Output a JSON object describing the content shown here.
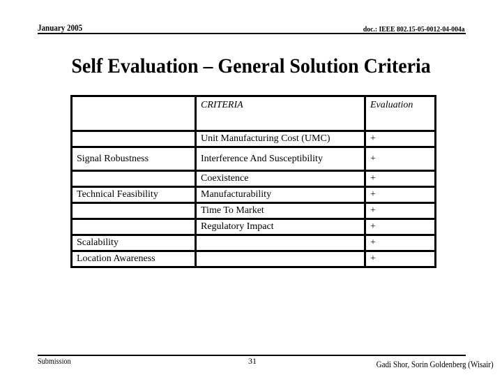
{
  "header": {
    "date": "January 2005",
    "doc_id": "doc.: IEEE 802.15-05-0012-04-004a"
  },
  "title": "Self Evaluation – General Solution Criteria",
  "table": {
    "columns": [
      "",
      "CRITERIA",
      "Evaluation"
    ],
    "rows": [
      [
        "",
        "Unit Manufacturing Cost (UMC)",
        "+"
      ],
      [
        "Signal Robustness",
        "Interference And Susceptibility",
        "+"
      ],
      [
        "",
        "Coexistence",
        "+"
      ],
      [
        "Technical Feasibility",
        "Manufacturability",
        "+"
      ],
      [
        "",
        "Time To Market",
        "+"
      ],
      [
        "",
        "Regulatory Impact",
        "+"
      ],
      [
        "Scalability",
        "",
        "+"
      ],
      [
        "Location Awareness",
        "",
        "+"
      ]
    ]
  },
  "footer": {
    "left": "Submission",
    "page_number": "31",
    "authors": "Gadi Shor, Sorin Goldenberg (Wisair)"
  }
}
